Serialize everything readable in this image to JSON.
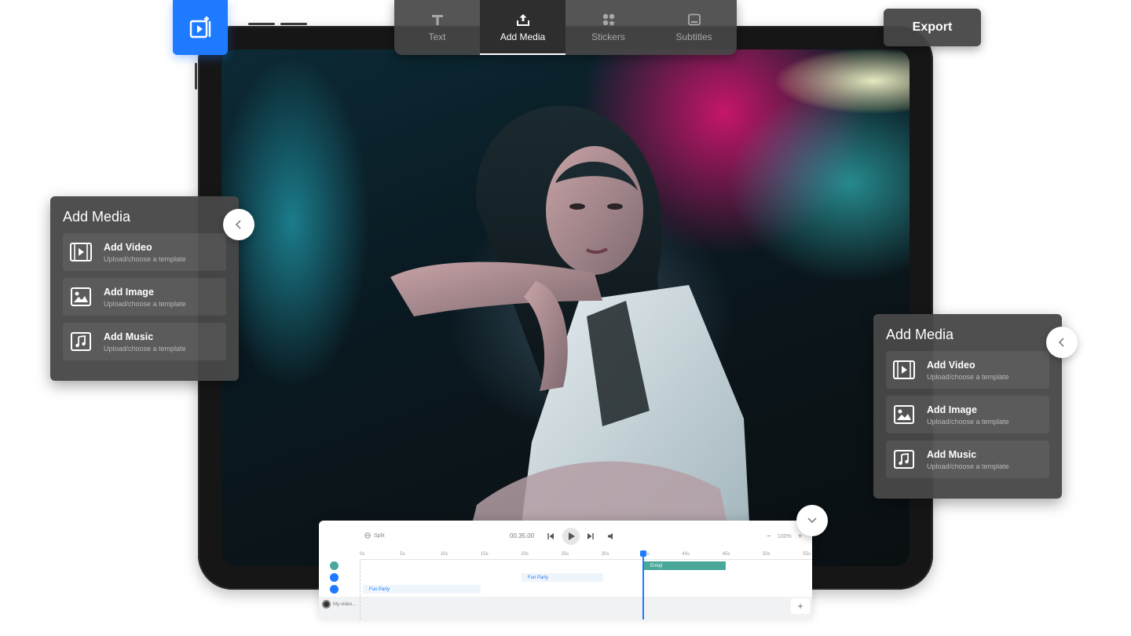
{
  "toolbar": {
    "tabs": [
      {
        "label": "Text",
        "icon": "text-icon"
      },
      {
        "label": "Add Media",
        "icon": "upload-icon"
      },
      {
        "label": "Stickers",
        "icon": "stickers-icon"
      },
      {
        "label": "Subtitles",
        "icon": "subtitles-icon"
      }
    ],
    "active_tab": "Add Media"
  },
  "export_label": "Export",
  "panels": {
    "left": {
      "title": "Add Media",
      "items": [
        {
          "label": "Add Video",
          "sub": "Upload/choose a template",
          "icon": "video-icon"
        },
        {
          "label": "Add Image",
          "sub": "Upload/choose a template",
          "icon": "image-icon"
        },
        {
          "label": "Add Music",
          "sub": "Upload/choose a template",
          "icon": "music-icon"
        }
      ]
    },
    "right": {
      "title": "Add Media",
      "items": [
        {
          "label": "Add Video",
          "sub": "Upload/choose a template",
          "icon": "video-icon"
        },
        {
          "label": "Add Image",
          "sub": "Upload/choose a template",
          "icon": "image-icon"
        },
        {
          "label": "Add Music",
          "sub": "Upload/choose a template",
          "icon": "music-icon"
        }
      ]
    }
  },
  "timeline": {
    "split_label": "Split",
    "current_time": "00.35.00",
    "zoom": "100%",
    "ruler": [
      "0s",
      "5s",
      "10s",
      "15s",
      "20s",
      "25s",
      "30s",
      "35s",
      "40s",
      "45s",
      "50s",
      "55s"
    ],
    "clips": {
      "emoji": "Emoji",
      "text_upper": "Fun Party",
      "text_lower": "Fun Party"
    },
    "video_track": "My-video..."
  },
  "colors": {
    "accent": "#1e7bff",
    "panel_bg": "#484848",
    "toolbar_bg": "#464646",
    "emoji_clip": "#4aa89a"
  }
}
